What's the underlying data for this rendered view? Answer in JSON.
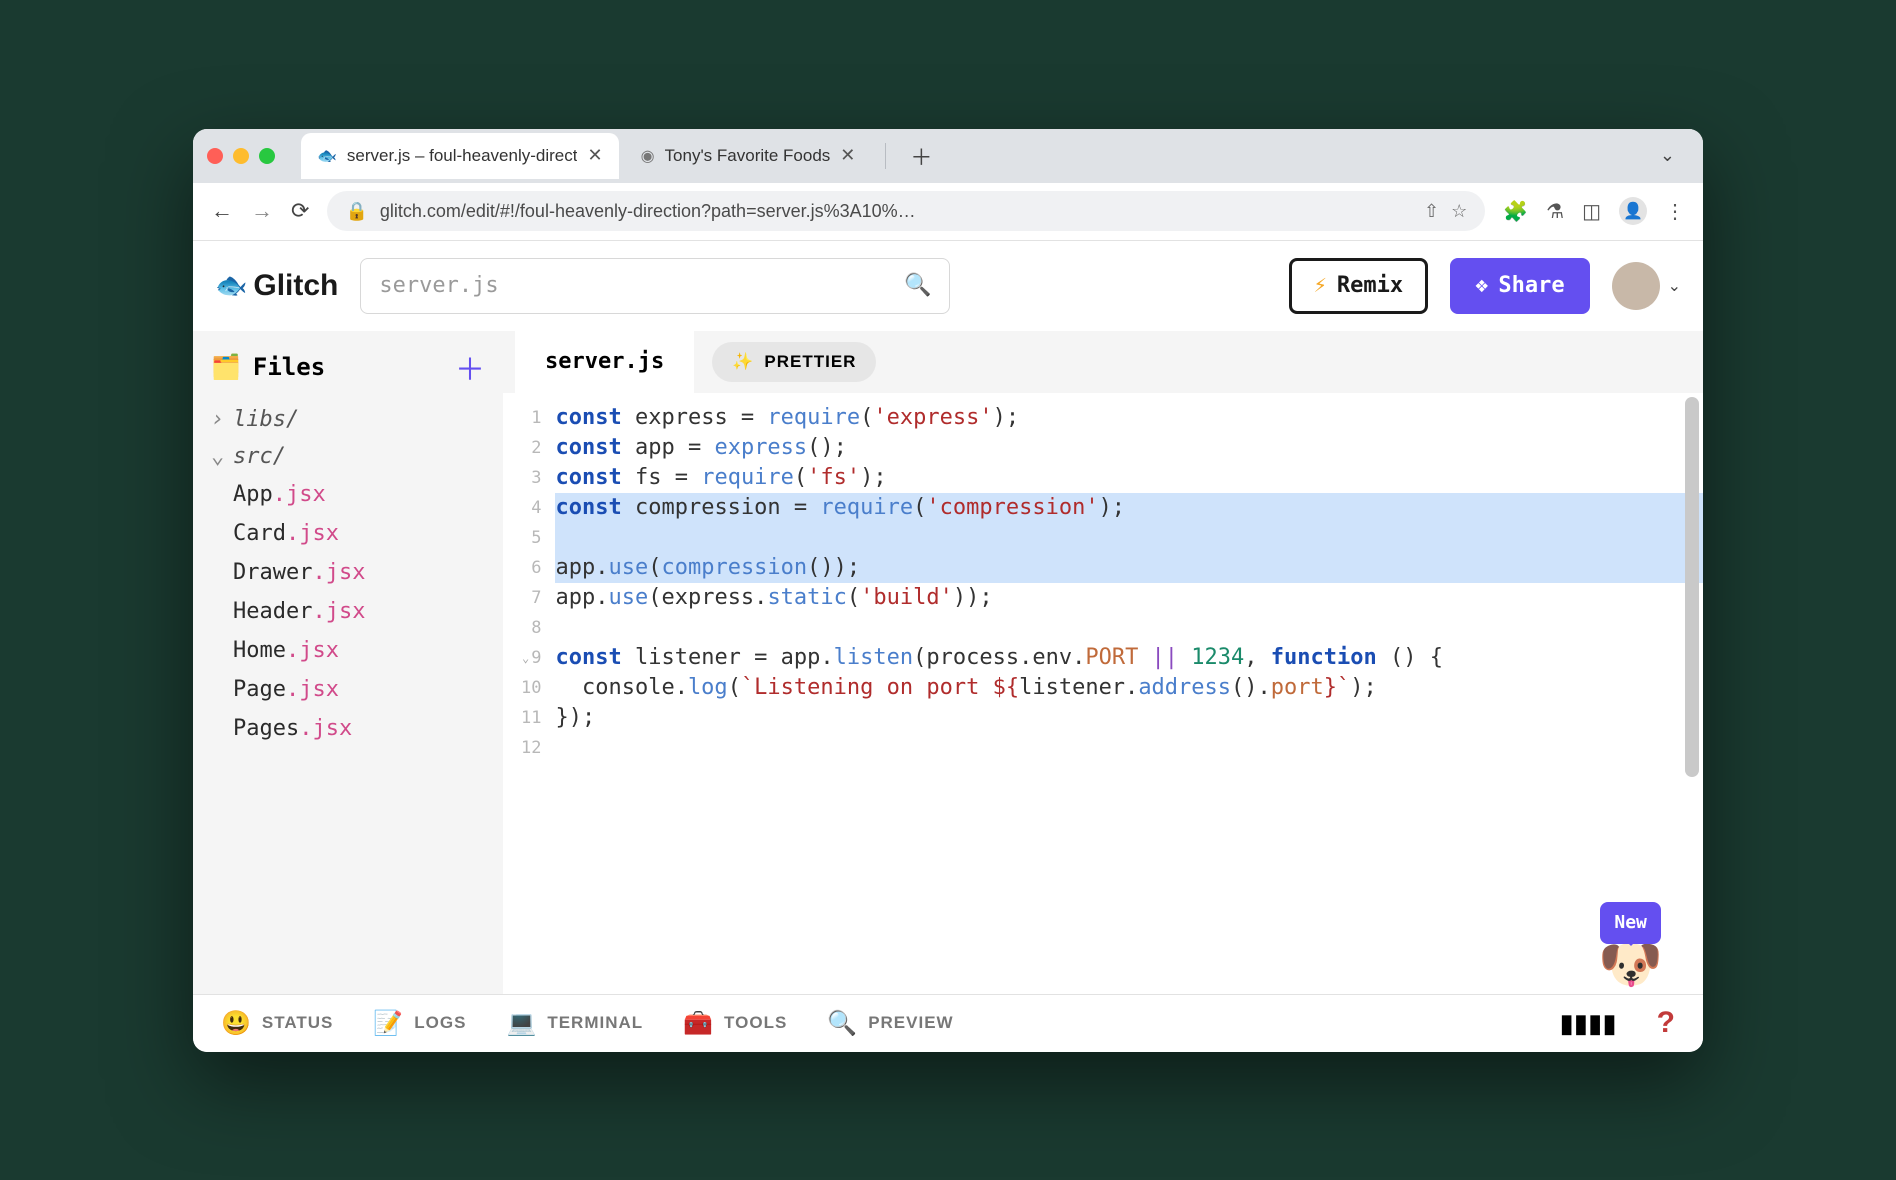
{
  "browser": {
    "tabs": [
      {
        "title": "server.js – foul-heavenly-direct",
        "favicon": "🐟",
        "active": true
      },
      {
        "title": "Tony's Favorite Foods",
        "favicon": "◉",
        "active": false
      }
    ],
    "url": "glitch.com/edit/#!/foul-heavenly-direction?path=server.js%3A10%…"
  },
  "glitch": {
    "brand": "Glitch",
    "search_placeholder": "server.js",
    "remix_label": "Remix",
    "share_label": "Share"
  },
  "sidebar": {
    "title": "Files",
    "folders": [
      {
        "name": "libs/",
        "expanded": false
      },
      {
        "name": "src/",
        "expanded": true
      }
    ],
    "files": [
      {
        "base": "App",
        "ext": ".jsx"
      },
      {
        "base": "Card",
        "ext": ".jsx"
      },
      {
        "base": "Drawer",
        "ext": ".jsx"
      },
      {
        "base": "Header",
        "ext": ".jsx"
      },
      {
        "base": "Home",
        "ext": ".jsx"
      },
      {
        "base": "Page",
        "ext": ".jsx"
      },
      {
        "base": "Pages",
        "ext": ".jsx"
      }
    ]
  },
  "editor": {
    "tab_name": "server.js",
    "prettier_label": "PRETTIER",
    "highlighted_lines": [
      4,
      5,
      6
    ],
    "code": [
      [
        {
          "t": "const ",
          "c": "kw"
        },
        {
          "t": "express = ",
          "c": "pl"
        },
        {
          "t": "require",
          "c": "fn"
        },
        {
          "t": "(",
          "c": "pl"
        },
        {
          "t": "'express'",
          "c": "str"
        },
        {
          "t": ");",
          "c": "pl"
        }
      ],
      [
        {
          "t": "const ",
          "c": "kw"
        },
        {
          "t": "app = ",
          "c": "pl"
        },
        {
          "t": "express",
          "c": "fn"
        },
        {
          "t": "();",
          "c": "pl"
        }
      ],
      [
        {
          "t": "const ",
          "c": "kw"
        },
        {
          "t": "fs = ",
          "c": "pl"
        },
        {
          "t": "require",
          "c": "fn"
        },
        {
          "t": "(",
          "c": "pl"
        },
        {
          "t": "'fs'",
          "c": "str"
        },
        {
          "t": ");",
          "c": "pl"
        }
      ],
      [
        {
          "t": "const ",
          "c": "kw"
        },
        {
          "t": "compression = ",
          "c": "pl"
        },
        {
          "t": "require",
          "c": "fn"
        },
        {
          "t": "(",
          "c": "pl"
        },
        {
          "t": "'compression'",
          "c": "str"
        },
        {
          "t": ");",
          "c": "pl"
        }
      ],
      [],
      [
        {
          "t": "app.",
          "c": "pl"
        },
        {
          "t": "use",
          "c": "fn"
        },
        {
          "t": "(",
          "c": "pl"
        },
        {
          "t": "compression",
          "c": "fn"
        },
        {
          "t": "());",
          "c": "pl"
        }
      ],
      [
        {
          "t": "app.",
          "c": "pl"
        },
        {
          "t": "use",
          "c": "fn"
        },
        {
          "t": "(express.",
          "c": "pl"
        },
        {
          "t": "static",
          "c": "fn"
        },
        {
          "t": "(",
          "c": "pl"
        },
        {
          "t": "'build'",
          "c": "str"
        },
        {
          "t": "));",
          "c": "pl"
        }
      ],
      [],
      [
        {
          "t": "const ",
          "c": "kw"
        },
        {
          "t": "listener = app.",
          "c": "pl"
        },
        {
          "t": "listen",
          "c": "fn"
        },
        {
          "t": "(process.env.",
          "c": "pl"
        },
        {
          "t": "PORT",
          "c": "prop"
        },
        {
          "t": " || ",
          "c": "op"
        },
        {
          "t": "1234",
          "c": "num"
        },
        {
          "t": ", ",
          "c": "pl"
        },
        {
          "t": "function",
          "c": "kw"
        },
        {
          "t": " () {",
          "c": "pl"
        }
      ],
      [
        {
          "t": "  console.",
          "c": "pl"
        },
        {
          "t": "log",
          "c": "fn"
        },
        {
          "t": "(",
          "c": "pl"
        },
        {
          "t": "`Listening on port ${",
          "c": "str"
        },
        {
          "t": "listener.",
          "c": "pl"
        },
        {
          "t": "address",
          "c": "fn"
        },
        {
          "t": "().",
          "c": "pl"
        },
        {
          "t": "port",
          "c": "prop"
        },
        {
          "t": "}`",
          "c": "str"
        },
        {
          "t": ");",
          "c": "pl"
        }
      ],
      [
        {
          "t": "});",
          "c": "pl"
        }
      ],
      []
    ]
  },
  "newbadge": "New",
  "bottombar": {
    "items": [
      {
        "icon": "😃",
        "label": "STATUS"
      },
      {
        "icon": "📝",
        "label": "LOGS"
      },
      {
        "icon": "💻",
        "label": "TERMINAL"
      },
      {
        "icon": "🧰",
        "label": "TOOLS"
      },
      {
        "icon": "🔍",
        "label": "PREVIEW"
      }
    ]
  }
}
